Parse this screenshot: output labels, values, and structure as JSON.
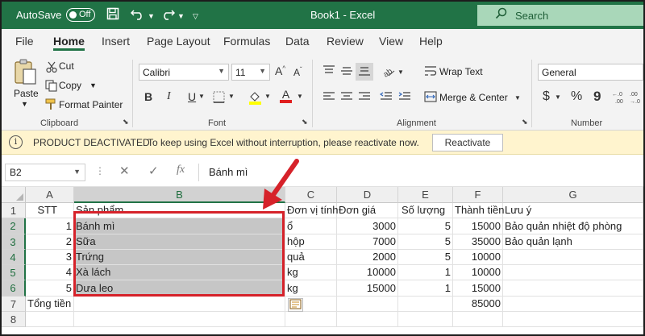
{
  "titlebar": {
    "autosave_label": "AutoSave",
    "autosave_state": "Off",
    "book_title": "Book1  -  Excel",
    "search_label": "Search",
    "search_icon": "magnifier-icon",
    "save_icon": "save-icon",
    "undo_icon": "undo-icon",
    "redo_icon": "redo-icon",
    "customize_icon": "chevron-down-icon",
    "bar_color": "#217346"
  },
  "menu": {
    "items": [
      "File",
      "Home",
      "Insert",
      "Page Layout",
      "Formulas",
      "Data",
      "Review",
      "View",
      "Help"
    ],
    "active": "Home"
  },
  "ribbon": {
    "clipboard": {
      "paste": "Paste",
      "cut": "Cut",
      "copy": "Copy",
      "format_painter": "Format Painter",
      "group_label": "Clipboard"
    },
    "font": {
      "name": "Calibri",
      "size": "11",
      "bold": "B",
      "italic": "I",
      "underline": "U",
      "font_color_letter": "A",
      "group_label": "Font"
    },
    "alignment": {
      "wrap_text": "Wrap Text",
      "merge_center": "Merge & Center",
      "group_label": "Alignment"
    },
    "number": {
      "format": "General",
      "currency": "$",
      "percent": "%",
      "comma": "9",
      "group_label": "Number"
    }
  },
  "notice": {
    "heading": "PRODUCT DEACTIVATED",
    "message": "To keep using Excel without interruption, please reactivate now.",
    "button": "Reactivate",
    "info_glyph": "i",
    "background": "#fff4ce"
  },
  "formula_bar": {
    "name_box": "B2",
    "fx": "fx",
    "content": "Bánh mì"
  },
  "sheet": {
    "columns": [
      "A",
      "B",
      "C",
      "D",
      "E",
      "F",
      "G"
    ],
    "selected_column": "B",
    "row_numbers": [
      "1",
      "2",
      "3",
      "4",
      "5",
      "6",
      "7",
      "8"
    ],
    "selected_rows": [
      "2",
      "3",
      "4",
      "5",
      "6"
    ],
    "rows": [
      [
        "STT",
        "Sản phẩm",
        "Đơn vị tính",
        "Đơn giá",
        "Số lượng",
        "Thành tiền",
        "Lưu ý"
      ],
      [
        "1",
        "Bánh mì",
        "ổ",
        "3000",
        "5",
        "15000",
        "Bảo quản nhiệt độ phòng"
      ],
      [
        "2",
        "Sữa",
        "hộp",
        "7000",
        "5",
        "35000",
        "Bảo quản lạnh"
      ],
      [
        "3",
        "Trứng",
        "quả",
        "2000",
        "5",
        "10000",
        ""
      ],
      [
        "4",
        "Xà lách",
        "kg",
        "10000",
        "1",
        "10000",
        ""
      ],
      [
        "5",
        "Dưa leo",
        "kg",
        "15000",
        "1",
        "15000",
        ""
      ],
      [
        "Tổng tiền",
        "",
        "",
        "",
        "",
        "85000",
        ""
      ],
      [
        "",
        "",
        "",
        "",
        "",
        "",
        ""
      ]
    ],
    "selection_color": "#c6c6c6",
    "highlight_border_color": "#d6222a",
    "arrow_color": "#d6222a"
  }
}
